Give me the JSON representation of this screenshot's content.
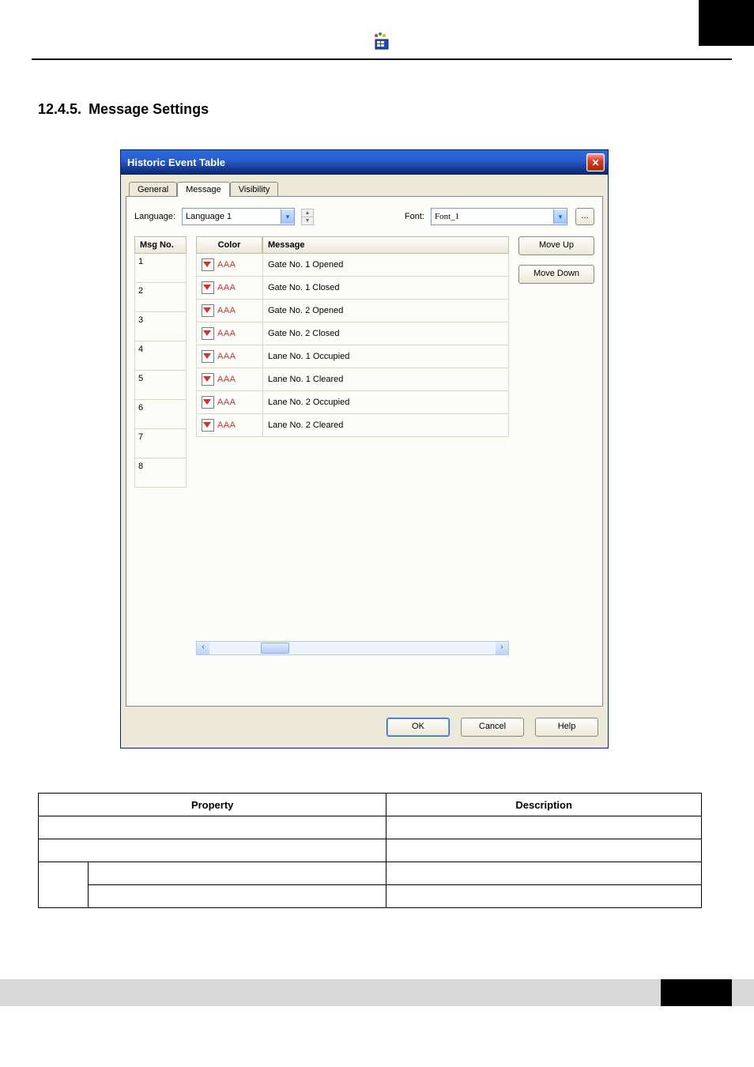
{
  "section": {
    "number": "12.4.5.",
    "title": "Message Settings"
  },
  "dialog": {
    "title": "Historic Event Table",
    "close_glyph": "✕",
    "tabs": {
      "general": "General",
      "message": "Message",
      "visibility": "Visibility"
    },
    "row1": {
      "language_label": "Language:",
      "language_value": "Language 1",
      "font_label": "Font:",
      "font_value": "Font_1",
      "dots": "..."
    },
    "headers": {
      "msgno": "Msg No.",
      "color": "Color",
      "message": "Message"
    },
    "color_sample_text": "AAA",
    "rows": [
      {
        "no": "1",
        "msg": "Gate No. 1 Opened"
      },
      {
        "no": "2",
        "msg": "Gate No. 1 Closed"
      },
      {
        "no": "3",
        "msg": "Gate No. 2 Opened"
      },
      {
        "no": "4",
        "msg": "Gate No. 2 Closed"
      },
      {
        "no": "5",
        "msg": "Lane No. 1 Occupied"
      },
      {
        "no": "6",
        "msg": "Lane No. 1 Cleared"
      },
      {
        "no": "7",
        "msg": "Lane No. 2 Occupied"
      },
      {
        "no": "8",
        "msg": "Lane No. 2 Cleared"
      }
    ],
    "side": {
      "move_up": "Move Up",
      "move_down": "Move Down"
    },
    "footer": {
      "ok": "OK",
      "cancel": "Cancel",
      "help": "Help"
    }
  },
  "pd": {
    "h_property": "Property",
    "h_description": "Description",
    "cells": {
      "r1c1": "",
      "r1c2": "",
      "r2c1": "",
      "r2c2": "",
      "r3c1a": "",
      "r3c1b": "",
      "r3c2": "",
      "r4c1b": "",
      "r4c2": ""
    }
  }
}
